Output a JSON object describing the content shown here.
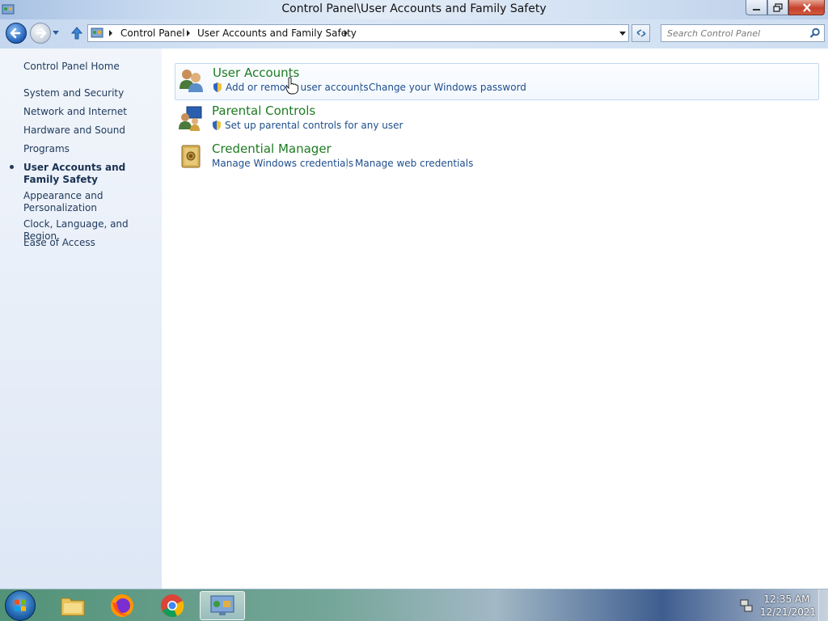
{
  "window": {
    "title": "Control Panel\\User Accounts and Family Safety"
  },
  "address": {
    "crumbs": [
      "Control Panel",
      "User Accounts and Family Safety"
    ]
  },
  "search": {
    "placeholder": "Search Control Panel"
  },
  "sidebar": {
    "home": "Control Panel Home",
    "items": [
      "System and Security",
      "Network and Internet",
      "Hardware and Sound",
      "Programs",
      "User Accounts and Family Safety",
      "Appearance and Personalization",
      "Clock, Language, and Region",
      "Ease of Access"
    ],
    "active_index": 4
  },
  "categories": [
    {
      "title": "User Accounts",
      "links": [
        "Add or remove user accounts",
        "Change your Windows password"
      ]
    },
    {
      "title": "Parental Controls",
      "links": [
        "Set up parental controls for any user"
      ]
    },
    {
      "title": "Credential Manager",
      "links": [
        "Manage Windows credentials",
        "Manage web credentials"
      ]
    }
  ],
  "taskbar": {
    "apps": [
      "file-explorer-icon",
      "firefox-icon",
      "chrome-icon",
      "control-panel-icon"
    ],
    "time": "12:35 AM",
    "date": "12/21/2021"
  },
  "colors": {
    "category_title": "#1e7b22",
    "link": "#1e4e8c",
    "sidebar_text": "#1e395b"
  }
}
